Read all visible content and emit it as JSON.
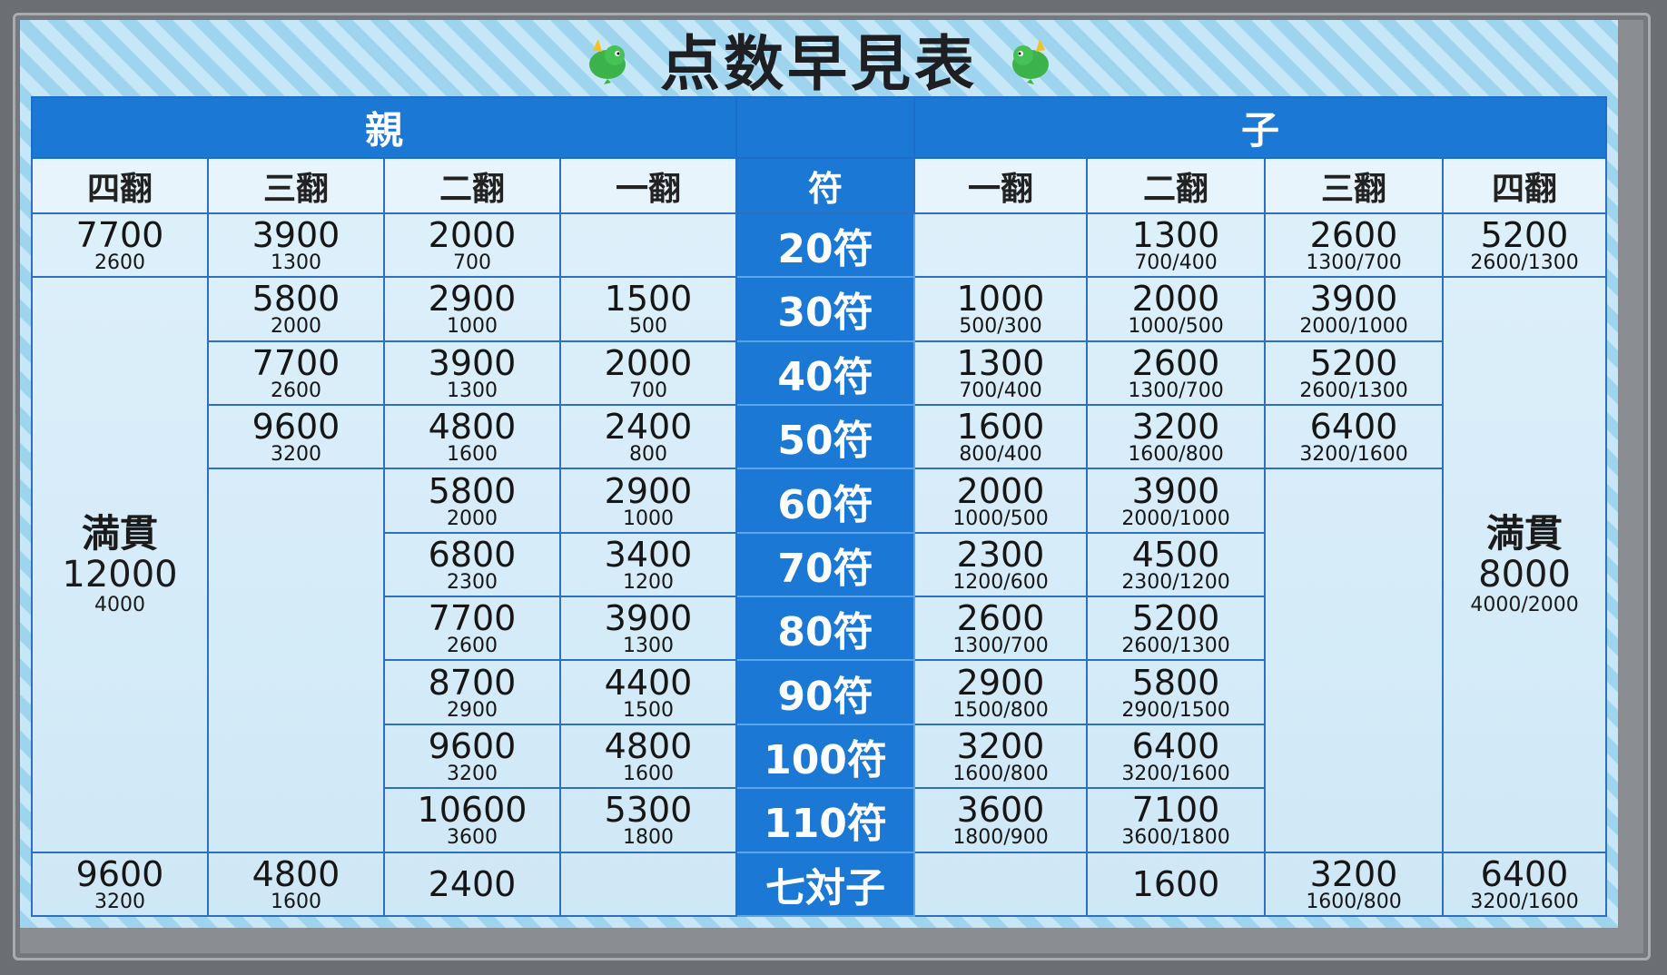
{
  "title": "点数早見表",
  "groups": {
    "dealer": "親",
    "non_dealer": "子"
  },
  "columns": {
    "dealer": [
      "四翻",
      "三翻",
      "二翻",
      "一翻"
    ],
    "fu": "符",
    "non_dealer": [
      "一翻",
      "二翻",
      "三翻",
      "四翻"
    ]
  },
  "rows": [
    {
      "fu": "20符",
      "dealer": [
        {
          "main": "7700",
          "sub": "2600"
        },
        {
          "main": "3900",
          "sub": "1300"
        },
        {
          "main": "2000",
          "sub": "700"
        },
        null
      ],
      "non_dealer": [
        null,
        {
          "main": "1300",
          "sub": "700/400"
        },
        {
          "main": "2600",
          "sub": "1300/700"
        },
        {
          "main": "5200",
          "sub": "2600/1300"
        }
      ]
    },
    {
      "fu": "30符",
      "dealer": [
        "mangan",
        {
          "main": "5800",
          "sub": "2000"
        },
        {
          "main": "2900",
          "sub": "1000"
        },
        {
          "main": "1500",
          "sub": "500"
        }
      ],
      "non_dealer": [
        {
          "main": "1000",
          "sub": "500/300"
        },
        {
          "main": "2000",
          "sub": "1000/500"
        },
        {
          "main": "3900",
          "sub": "2000/1000"
        },
        "mangan"
      ]
    },
    {
      "fu": "40符",
      "dealer": [
        "mangan",
        {
          "main": "7700",
          "sub": "2600"
        },
        {
          "main": "3900",
          "sub": "1300"
        },
        {
          "main": "2000",
          "sub": "700"
        }
      ],
      "non_dealer": [
        {
          "main": "1300",
          "sub": "700/400"
        },
        {
          "main": "2600",
          "sub": "1300/700"
        },
        {
          "main": "5200",
          "sub": "2600/1300"
        },
        "mangan"
      ]
    },
    {
      "fu": "50符",
      "dealer": [
        "mangan",
        {
          "main": "9600",
          "sub": "3200"
        },
        {
          "main": "4800",
          "sub": "1600"
        },
        {
          "main": "2400",
          "sub": "800"
        }
      ],
      "non_dealer": [
        {
          "main": "1600",
          "sub": "800/400"
        },
        {
          "main": "3200",
          "sub": "1600/800"
        },
        {
          "main": "6400",
          "sub": "3200/1600"
        },
        "mangan"
      ]
    },
    {
      "fu": "60符",
      "dealer": [
        "mangan",
        "mangan",
        {
          "main": "5800",
          "sub": "2000"
        },
        {
          "main": "2900",
          "sub": "1000"
        }
      ],
      "non_dealer": [
        {
          "main": "2000",
          "sub": "1000/500"
        },
        {
          "main": "3900",
          "sub": "2000/1000"
        },
        "mangan",
        "mangan"
      ]
    },
    {
      "fu": "70符",
      "dealer": [
        "mangan",
        "mangan",
        {
          "main": "6800",
          "sub": "2300"
        },
        {
          "main": "3400",
          "sub": "1200"
        }
      ],
      "non_dealer": [
        {
          "main": "2300",
          "sub": "1200/600"
        },
        {
          "main": "4500",
          "sub": "2300/1200"
        },
        "mangan",
        "mangan"
      ]
    },
    {
      "fu": "80符",
      "dealer": [
        "mangan",
        "mangan",
        {
          "main": "7700",
          "sub": "2600"
        },
        {
          "main": "3900",
          "sub": "1300"
        }
      ],
      "non_dealer": [
        {
          "main": "2600",
          "sub": "1300/700"
        },
        {
          "main": "5200",
          "sub": "2600/1300"
        },
        "mangan",
        "mangan"
      ]
    },
    {
      "fu": "90符",
      "dealer": [
        "mangan",
        "mangan",
        {
          "main": "8700",
          "sub": "2900"
        },
        {
          "main": "4400",
          "sub": "1500"
        }
      ],
      "non_dealer": [
        {
          "main": "2900",
          "sub": "1500/800"
        },
        {
          "main": "5800",
          "sub": "2900/1500"
        },
        "mangan",
        "mangan"
      ]
    },
    {
      "fu": "100符",
      "dealer": [
        "mangan",
        "mangan",
        {
          "main": "9600",
          "sub": "3200"
        },
        {
          "main": "4800",
          "sub": "1600"
        }
      ],
      "non_dealer": [
        {
          "main": "3200",
          "sub": "1600/800"
        },
        {
          "main": "6400",
          "sub": "3200/1600"
        },
        "mangan",
        "mangan"
      ]
    },
    {
      "fu": "110符",
      "dealer": [
        "mangan",
        "mangan",
        {
          "main": "10600",
          "sub": "3600"
        },
        {
          "main": "5300",
          "sub": "1800"
        }
      ],
      "non_dealer": [
        {
          "main": "3600",
          "sub": "1800/900"
        },
        {
          "main": "7100",
          "sub": "3600/1800"
        },
        "mangan",
        "mangan"
      ]
    },
    {
      "fu": "七対子",
      "dealer": [
        {
          "main": "9600",
          "sub": "3200"
        },
        {
          "main": "4800",
          "sub": "1600"
        },
        {
          "main": "2400",
          "sub": ""
        },
        null
      ],
      "non_dealer": [
        null,
        {
          "main": "1600",
          "sub": ""
        },
        {
          "main": "3200",
          "sub": "1600/800"
        },
        {
          "main": "6400",
          "sub": "3200/1600"
        }
      ]
    }
  ],
  "mangan": {
    "dealer": {
      "label": "満貫",
      "main": "12000",
      "sub": "4000"
    },
    "non_dealer": {
      "label": "満貫",
      "main": "8000",
      "sub": "4000/2000"
    }
  },
  "colors": {
    "header_blue": "#1b78d4",
    "stripe_light": "#c6e7f7",
    "stripe_dark": "#9fd4ef",
    "cell_bg": "#dff1fb"
  },
  "icons": {
    "mascot": "green-dragon-mascot-icon"
  }
}
